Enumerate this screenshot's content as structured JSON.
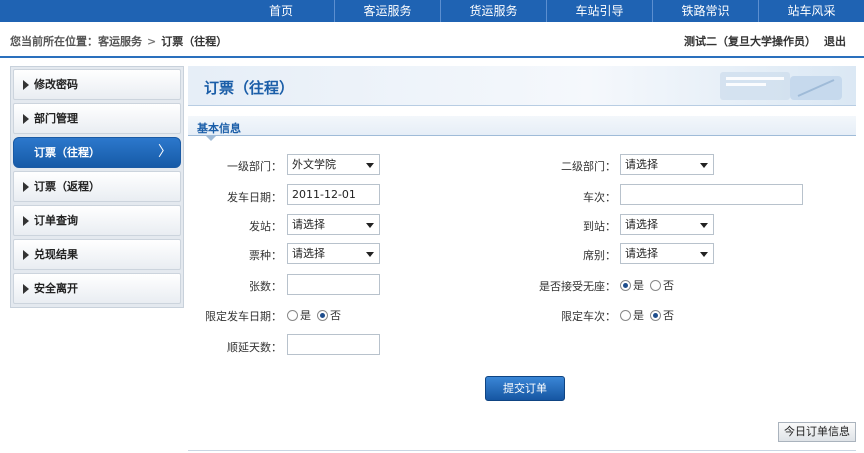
{
  "topnav": {
    "items": [
      "首页",
      "客运服务",
      "货运服务",
      "车站引导",
      "铁路常识",
      "站车风采"
    ]
  },
  "breadcrumb": {
    "prefix": "您当前所在位置：",
    "section": "客运服务",
    "separator": ">",
    "current": "订票（往程）"
  },
  "user": {
    "name": "测试二（复旦大学操作员）",
    "logout": "退出"
  },
  "sidebar": {
    "items": [
      {
        "label": "修改密码",
        "active": false
      },
      {
        "label": "部门管理",
        "active": false
      },
      {
        "label": "订票（往程）",
        "active": true
      },
      {
        "label": "订票（返程）",
        "active": false
      },
      {
        "label": "订单查询",
        "active": false
      },
      {
        "label": "兑现结果",
        "active": false
      },
      {
        "label": "安全离开",
        "active": false
      }
    ],
    "active_chevron": "〉"
  },
  "main": {
    "title": "订票（往程）",
    "section_title": "基本信息"
  },
  "form": {
    "dept1": {
      "label": "一级部门：",
      "value": "外文学院"
    },
    "dept2": {
      "label": "二级部门：",
      "value": "请选择"
    },
    "date": {
      "label": "发车日期：",
      "value": "2011-12-01"
    },
    "train": {
      "label": "车次：",
      "value": ""
    },
    "from": {
      "label": "发站：",
      "value": "请选择"
    },
    "to": {
      "label": "到站：",
      "value": "请选择"
    },
    "ticket_type": {
      "label": "票种：",
      "value": "请选择"
    },
    "seat_type": {
      "label": "席别：",
      "value": "请选择"
    },
    "count": {
      "label": "张数：",
      "value": ""
    },
    "no_seat": {
      "label": "是否接受无座：",
      "yes": "是",
      "no": "否",
      "selected": "是"
    },
    "limit_date": {
      "label": "限定发车日期：",
      "yes": "是",
      "no": "否",
      "selected": "否"
    },
    "limit_train": {
      "label": "限定车次：",
      "yes": "是",
      "no": "否",
      "selected": "否"
    },
    "delay_days": {
      "label": "顺延天数：",
      "value": ""
    }
  },
  "buttons": {
    "submit": "提交订单",
    "today_orders": "今日订单信息"
  },
  "colors": {
    "nav_bg": "#1f63b3",
    "accent": "#1b5ea8",
    "active_item": "#2c78cc"
  }
}
